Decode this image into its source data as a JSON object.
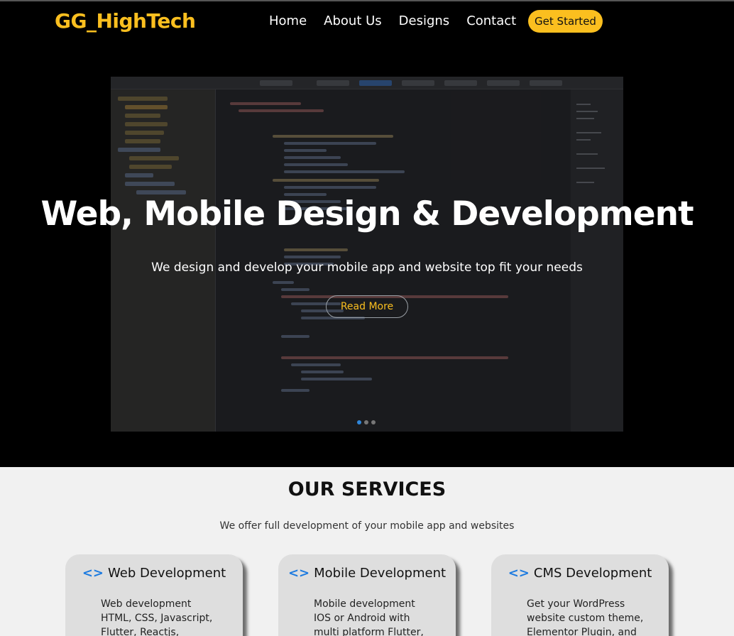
{
  "header": {
    "logo": "GG_HighTech",
    "nav": [
      "Home",
      "About Us",
      "Designs",
      "Contact"
    ],
    "cta": "Get Started"
  },
  "hero": {
    "title": "Web, Mobile Design & Development",
    "subtitle": "We design and develop your mobile app and website top fit your needs",
    "button": "Read More",
    "carousel": {
      "slides": 3,
      "active": 1
    }
  },
  "services": {
    "title": "OUR SERVICES",
    "subtitle": "We offer full development of your mobile app and websites",
    "cards": [
      {
        "icon": "code-icon",
        "title": "Web Development",
        "lines": [
          "Web development",
          "HTML, CSS, Javascript,",
          "Flutter, Reactjs,"
        ]
      },
      {
        "icon": "code-icon",
        "title": "Mobile Development",
        "lines": [
          "Mobile development",
          "IOS or Android with",
          "multi platform Flutter,"
        ]
      },
      {
        "icon": "code-icon",
        "title": "CMS Development",
        "lines": [
          "Get your WordPress",
          "website custom theme,",
          "Elementor Plugin,  and"
        ]
      }
    ]
  },
  "colors": {
    "brand": "#fbbf1f",
    "accent": "#1d7be0",
    "background": "#000000"
  }
}
